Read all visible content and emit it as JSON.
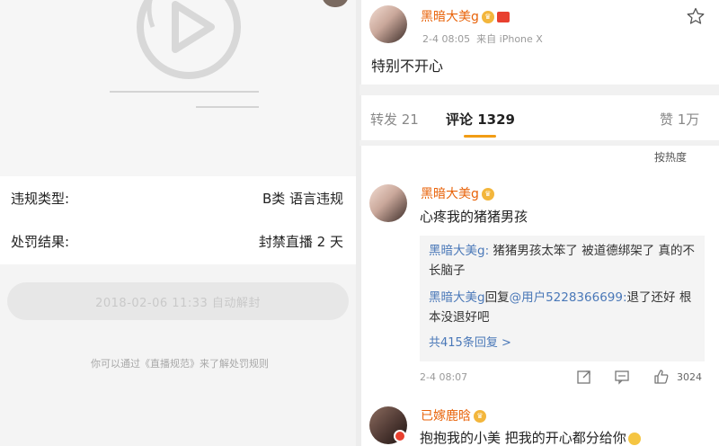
{
  "left": {
    "violation_type_label": "违规类型:",
    "violation_type_value": "B类 语言违规",
    "penalty_label": "处罚结果:",
    "penalty_value": "封禁直播 2 天",
    "unban_button": "2018-02-06 11:33 自动解封",
    "rules_note": "你可以通过《直播规范》来了解处罚规则"
  },
  "post": {
    "username": "黑暗大美g",
    "time": "2-4 08:05",
    "source": "来自 iPhone X",
    "text": "特别不开心"
  },
  "tabs": {
    "repost": "转发 21",
    "comments": "评论 1329",
    "likes": "赞 1万"
  },
  "sort_label": "按热度",
  "comments": [
    {
      "username": "黑暗大美g",
      "text": "心疼我的猪猪男孩",
      "replies": [
        {
          "author": "黑暗大美g:",
          "text": " 猪猪男孩太笨了 被道德绑架了 真的不长脑子"
        },
        {
          "author": "黑暗大美g",
          "middle": "回复",
          "mention": "@用户5228366699:",
          "text": "退了还好 根本没退好吧"
        }
      ],
      "more_replies": "共415条回复 >",
      "time": "2-4 08:07",
      "likes": "3024"
    },
    {
      "username": "已嫁鹿晗",
      "text": "抱抱我的小美 把我的开心都分给你"
    }
  ],
  "colors": {
    "username": "#e8630a",
    "link": "#4a78b8",
    "tab_underline": "#f19c14"
  }
}
